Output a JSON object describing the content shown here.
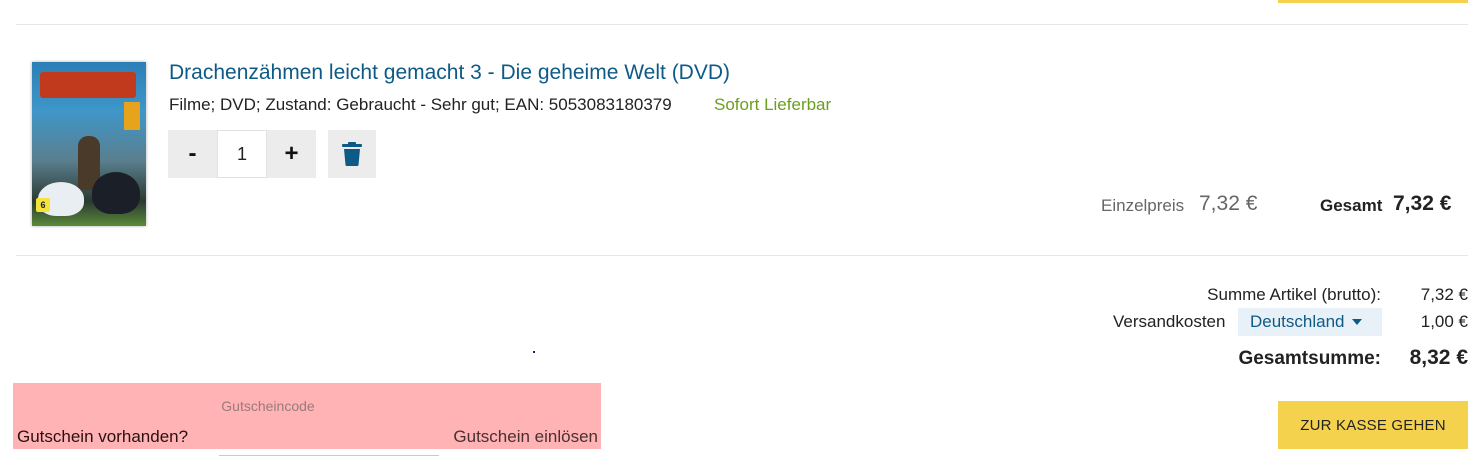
{
  "product": {
    "title": "Drachenzähmen leicht gemacht 3 - Die geheime Welt (DVD)",
    "meta": "Filme; DVD; Zustand: Gebraucht - Sehr gut; EAN: 5053083180379",
    "availability": "Sofort Lieferbar",
    "image_icon": "dvd-cover-image",
    "fsk_rating": "6"
  },
  "quantity": {
    "decrement_label": "-",
    "value": "1",
    "increment_label": "+",
    "delete_icon": "trash-icon"
  },
  "pricing": {
    "unit_label": "Einzelpreis",
    "unit_price": "7,32 €",
    "total_label": "Gesamt",
    "total_price": "7,32 €"
  },
  "summary": {
    "items_label": "Summe Artikel (brutto):",
    "items_value": "7,32 €",
    "shipping_label": "Versandkosten",
    "shipping_country": "Deutschland",
    "shipping_value": "1,00 €",
    "grand_label": "Gesamtsumme:",
    "grand_value": "8,32 €"
  },
  "voucher": {
    "code_label": "Gutscheincode",
    "question": "Gutschein vorhanden?",
    "redeem_label": "Gutschein einlösen"
  },
  "checkout": {
    "label": "ZUR KASSE GEHEN"
  },
  "colors": {
    "link": "#0e5a86",
    "available": "#6b9e1e",
    "checkout_bg": "#f5d24d",
    "voucher_bg": "#ffb3b5",
    "button_bg": "#ececec"
  }
}
